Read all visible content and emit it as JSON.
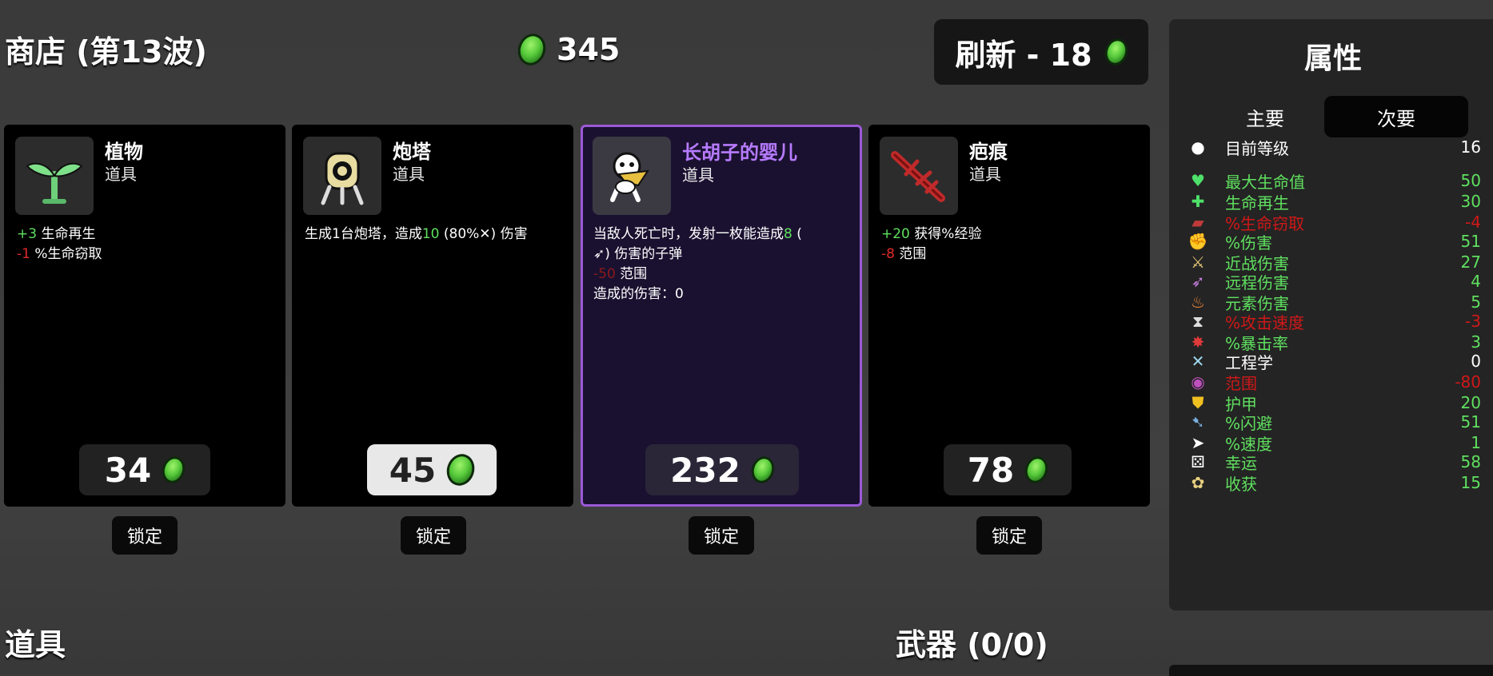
{
  "header": {
    "shop_title": "商店 (第13波)",
    "materials": "345",
    "reroll_label": "刷新 - 18"
  },
  "items": [
    {
      "name": "植物",
      "type": "道具",
      "price": "34",
      "lock_label": "锁定",
      "desc": [
        {
          "parts": [
            {
              "t": "+3",
              "c": "g"
            },
            {
              "t": " 生命再生",
              "c": ""
            }
          ]
        },
        {
          "parts": [
            {
              "t": "-1",
              "c": "r"
            },
            {
              "t": " %生命窃取",
              "c": ""
            }
          ]
        }
      ]
    },
    {
      "name": "炮塔",
      "type": "道具",
      "price": "45",
      "lock_label": "锁定",
      "desc": [
        {
          "parts": [
            {
              "t": "生成1台炮塔，造成",
              "c": ""
            },
            {
              "t": "10",
              "c": "g"
            },
            {
              "t": " (80%✕) 伤害",
              "c": ""
            }
          ]
        }
      ]
    },
    {
      "name": "长胡子的婴儿",
      "type": "道具",
      "price": "232",
      "lock_label": "锁定",
      "desc": [
        {
          "parts": [
            {
              "t": "当敌人死亡时，发射一枚能造成",
              "c": ""
            },
            {
              "t": "8",
              "c": "g"
            },
            {
              "t": " (",
              "c": ""
            }
          ]
        },
        {
          "parts": [
            {
              "t": "➶) 伤害的子弹",
              "c": ""
            }
          ]
        },
        {
          "parts": [
            {
              "t": "-50",
              "c": "dr"
            },
            {
              "t": " 范围",
              "c": ""
            }
          ]
        },
        {
          "parts": [
            {
              "t": "造成的伤害：0",
              "c": ""
            }
          ]
        }
      ]
    },
    {
      "name": "疤痕",
      "type": "道具",
      "price": "78",
      "lock_label": "锁定",
      "desc": [
        {
          "parts": [
            {
              "t": "+20",
              "c": "g"
            },
            {
              "t": " 获得%经验",
              "c": ""
            }
          ]
        },
        {
          "parts": [
            {
              "t": "-8",
              "c": "r"
            },
            {
              "t": " 范围",
              "c": ""
            }
          ]
        }
      ]
    }
  ],
  "sections": {
    "items_title": "道具",
    "weapons_title": "武器 (0/0)"
  },
  "stats_panel": {
    "title": "属性",
    "tab_primary": "主要",
    "tab_secondary": "次要",
    "rows": [
      {
        "icon": "level-icon",
        "glyph": "●",
        "label": "目前等级",
        "value": "16",
        "color": "sw",
        "icolor": "#ffffff"
      },
      {
        "icon": "heart-icon",
        "glyph": "♥",
        "label": "最大生命值",
        "value": "50",
        "color": "sg",
        "icolor": "#4ee06a"
      },
      {
        "icon": "regen-icon",
        "glyph": "✚",
        "label": "生命再生",
        "value": "30",
        "color": "sg",
        "icolor": "#4ee06a"
      },
      {
        "icon": "lifesteal-icon",
        "glyph": "▰",
        "label": "%生命窃取",
        "value": "-4",
        "color": "sr",
        "icolor": "#c03a3a"
      },
      {
        "icon": "damage-icon",
        "glyph": "✊",
        "label": "%伤害",
        "value": "51",
        "color": "sg",
        "icolor": "#e06a6a"
      },
      {
        "icon": "melee-icon",
        "glyph": "⚔",
        "label": "近战伤害",
        "value": "27",
        "color": "sg",
        "icolor": "#e8c878"
      },
      {
        "icon": "ranged-icon",
        "glyph": "➶",
        "label": "远程伤害",
        "value": "4",
        "color": "sg",
        "icolor": "#c880e0"
      },
      {
        "icon": "elemental-icon",
        "glyph": "♨",
        "label": "元素伤害",
        "value": "5",
        "color": "sg",
        "icolor": "#f08a3a"
      },
      {
        "icon": "attack-speed-icon",
        "glyph": "⧗",
        "label": "%攻击速度",
        "value": "-3",
        "color": "sr",
        "icolor": "#dddddd"
      },
      {
        "icon": "crit-icon",
        "glyph": "✸",
        "label": "%暴击率",
        "value": "3",
        "color": "sg",
        "icolor": "#e03a3a"
      },
      {
        "icon": "engineering-icon",
        "glyph": "✕",
        "label": "工程学",
        "value": "0",
        "color": "sw",
        "icolor": "#a0d8f0"
      },
      {
        "icon": "range-icon",
        "glyph": "◉",
        "label": "范围",
        "value": "-80",
        "color": "sr",
        "icolor": "#c050c0"
      },
      {
        "icon": "armor-icon",
        "glyph": "⛊",
        "label": "护甲",
        "value": "20",
        "color": "sg",
        "icolor": "#f0c020"
      },
      {
        "icon": "dodge-icon",
        "glyph": "➷",
        "label": "%闪避",
        "value": "51",
        "color": "sg",
        "icolor": "#7ab0e0"
      },
      {
        "icon": "speed-icon",
        "glyph": "➤",
        "label": "%速度",
        "value": "1",
        "color": "sg",
        "icolor": "#ffffff"
      },
      {
        "icon": "luck-icon",
        "glyph": "⚄",
        "label": "幸运",
        "value": "58",
        "color": "sg",
        "icolor": "#ffffff"
      },
      {
        "icon": "harvest-icon",
        "glyph": "✿",
        "label": "收获",
        "value": "15",
        "color": "sg",
        "icolor": "#e8d080"
      }
    ]
  }
}
